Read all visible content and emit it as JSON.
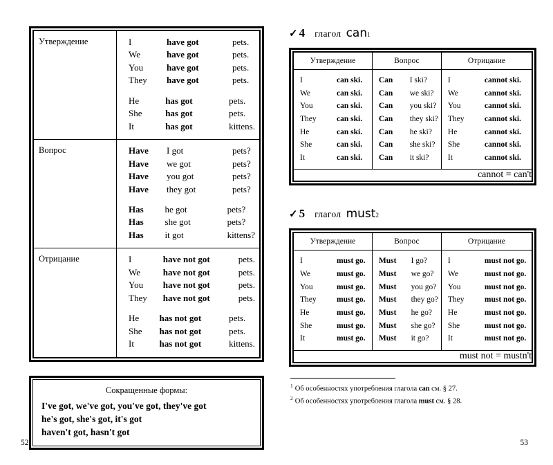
{
  "left_page": {
    "folio": "52",
    "have_got_table": {
      "sections": [
        {
          "label": "Утверждение",
          "groups": [
            [
              {
                "pronoun": "I",
                "aux": "have got",
                "object": "pets."
              },
              {
                "pronoun": "We",
                "aux": "have got",
                "object": "pets."
              },
              {
                "pronoun": "You",
                "aux": "have got",
                "object": "pets."
              },
              {
                "pronoun": "They",
                "aux": "have got",
                "object": "pets."
              }
            ],
            [
              {
                "pronoun": "He",
                "aux": "has got",
                "object": "pets."
              },
              {
                "pronoun": "She",
                "aux": "has got",
                "object": "pets."
              },
              {
                "pronoun": "It",
                "aux": "has got",
                "object": "kittens."
              }
            ]
          ]
        },
        {
          "label": "Вопрос",
          "groups": [
            [
              {
                "pronoun": "Have",
                "aux": "I got",
                "object": "pets?"
              },
              {
                "pronoun": "Have",
                "aux": "we got",
                "object": "pets?"
              },
              {
                "pronoun": "Have",
                "aux": "you got",
                "object": "pets?"
              },
              {
                "pronoun": "Have",
                "aux": "they got",
                "object": "pets?"
              }
            ],
            [
              {
                "pronoun": "Has",
                "aux": "he got",
                "object": "pets?"
              },
              {
                "pronoun": "Has",
                "aux": "she got",
                "object": "pets?"
              },
              {
                "pronoun": "Has",
                "aux": "it got",
                "object": "kittens?"
              }
            ]
          ]
        },
        {
          "label": "Отрицание",
          "groups": [
            [
              {
                "pronoun": "I",
                "aux": "have not got",
                "object": "pets."
              },
              {
                "pronoun": "We",
                "aux": "have not got",
                "object": "pets."
              },
              {
                "pronoun": "You",
                "aux": "have not got",
                "object": "pets."
              },
              {
                "pronoun": "They",
                "aux": "have not got",
                "object": "pets."
              }
            ],
            [
              {
                "pronoun": "He",
                "aux": "has not got",
                "object": "pets."
              },
              {
                "pronoun": "She",
                "aux": "has not got",
                "object": "pets."
              },
              {
                "pronoun": "It",
                "aux": "has not got",
                "object": "kittens."
              }
            ]
          ]
        }
      ]
    },
    "short_forms": {
      "title": "Сокращенные формы:",
      "lines": [
        "I've got, we've got, you've got, they've got",
        "he's got, she's got, it's got",
        "haven't got, hasn't got"
      ]
    }
  },
  "right_page": {
    "folio": "53",
    "sections": [
      {
        "check": "✓",
        "number": "4",
        "word": "глагол",
        "verb": "can",
        "footnote_mark": "1",
        "headers": [
          "Утверждение",
          "Вопрос",
          "Отрицание"
        ],
        "affirmative": [
          {
            "pronoun": "I",
            "predicate": "can ski."
          },
          {
            "pronoun": "We",
            "predicate": "can ski."
          },
          {
            "pronoun": "You",
            "predicate": "can ski."
          },
          {
            "pronoun": "They",
            "predicate": "can ski."
          },
          {
            "pronoun": "He",
            "predicate": "can ski."
          },
          {
            "pronoun": "She",
            "predicate": "can ski."
          },
          {
            "pronoun": "It",
            "predicate": "can ski."
          }
        ],
        "question": [
          {
            "aux": "Can",
            "rest": "I ski?"
          },
          {
            "aux": "Can",
            "rest": "we ski?"
          },
          {
            "aux": "Can",
            "rest": "you ski?"
          },
          {
            "aux": "Can",
            "rest": "they ski?"
          },
          {
            "aux": "Can",
            "rest": "he ski?"
          },
          {
            "aux": "Can",
            "rest": "she ski?"
          },
          {
            "aux": "Can",
            "rest": "it ski?"
          }
        ],
        "negative": [
          {
            "pronoun": "I",
            "predicate": "cannot ski."
          },
          {
            "pronoun": "We",
            "predicate": "cannot ski."
          },
          {
            "pronoun": "You",
            "predicate": "cannot ski."
          },
          {
            "pronoun": "They",
            "predicate": "cannot ski."
          },
          {
            "pronoun": "He",
            "predicate": "cannot ski."
          },
          {
            "pronoun": "She",
            "predicate": "cannot ski."
          },
          {
            "pronoun": "It",
            "predicate": "cannot ski."
          }
        ],
        "footer_note": "cannot = can't"
      },
      {
        "check": "✓",
        "number": "5",
        "word": "глагол",
        "verb": "must",
        "footnote_mark": "2",
        "headers": [
          "Утверждение",
          "Вопрос",
          "Отрицание"
        ],
        "affirmative": [
          {
            "pronoun": "I",
            "predicate": "must go."
          },
          {
            "pronoun": "We",
            "predicate": "must go."
          },
          {
            "pronoun": "You",
            "predicate": "must go."
          },
          {
            "pronoun": "They",
            "predicate": "must go."
          },
          {
            "pronoun": "He",
            "predicate": "must go."
          },
          {
            "pronoun": "She",
            "predicate": "must go."
          },
          {
            "pronoun": "It",
            "predicate": "must go."
          }
        ],
        "question": [
          {
            "aux": "Must",
            "rest": "I go?"
          },
          {
            "aux": "Must",
            "rest": "we go?"
          },
          {
            "aux": "Must",
            "rest": "you go?"
          },
          {
            "aux": "Must",
            "rest": "they go?"
          },
          {
            "aux": "Must",
            "rest": "he go?"
          },
          {
            "aux": "Must",
            "rest": "she go?"
          },
          {
            "aux": "Must",
            "rest": "it go?"
          }
        ],
        "negative": [
          {
            "pronoun": "I",
            "predicate": "must not go."
          },
          {
            "pronoun": "We",
            "predicate": "must not go."
          },
          {
            "pronoun": "You",
            "predicate": "must not go."
          },
          {
            "pronoun": "They",
            "predicate": "must not go."
          },
          {
            "pronoun": "He",
            "predicate": "must not go."
          },
          {
            "pronoun": "She",
            "predicate": "must not go."
          },
          {
            "pronoun": "It",
            "predicate": "must not go."
          }
        ],
        "footer_note": "must not = mustn't"
      }
    ],
    "footnotes": [
      {
        "mark": "1",
        "before": "Об особенностях употребления глагола ",
        "verb": "can",
        "after": " см. § 27."
      },
      {
        "mark": "2",
        "before": "Об особенностях употребления глагола ",
        "verb": "must",
        "after": " см. § 28."
      }
    ]
  }
}
